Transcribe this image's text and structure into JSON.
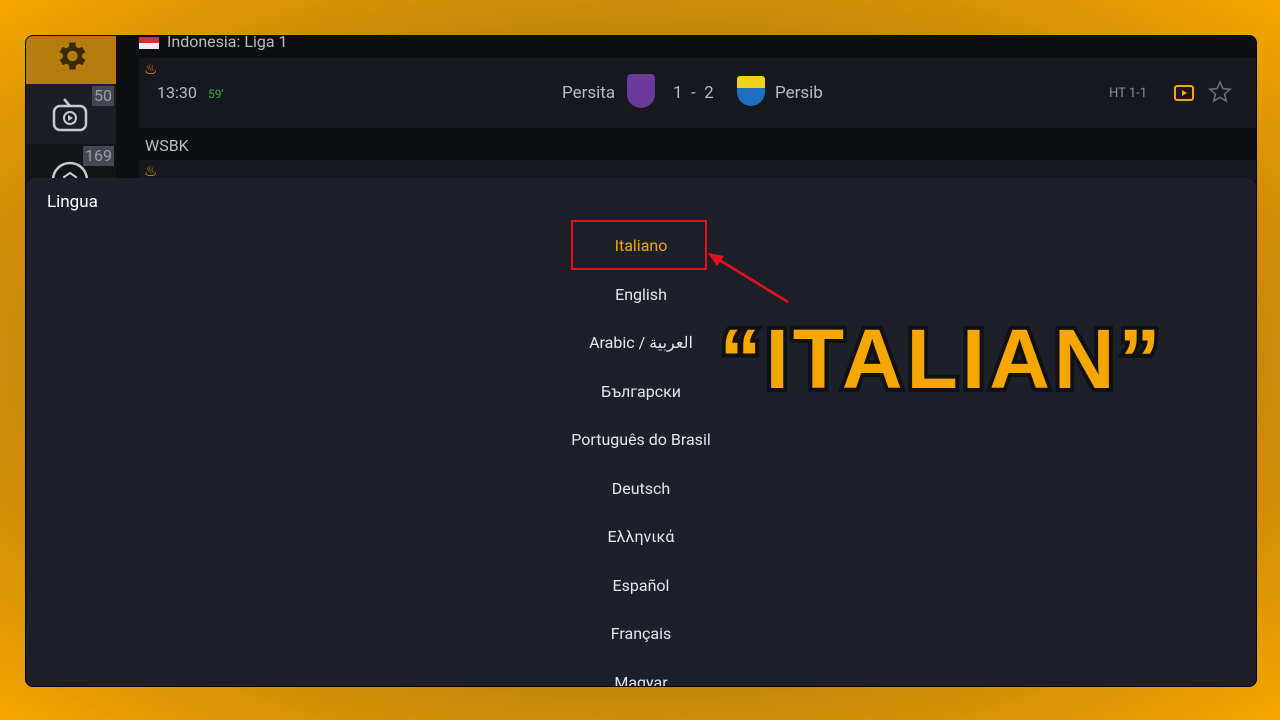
{
  "sidebar": {
    "items": [
      {
        "icon": "gear-icon",
        "count": ""
      },
      {
        "icon": "live-tv-icon",
        "count": "50"
      },
      {
        "icon": "soccer-ball-icon",
        "count": "169"
      }
    ]
  },
  "matches": {
    "league1": "Indonesia: Liga 1",
    "match1": {
      "time": "13:30",
      "minute": "59'",
      "home": "Persita",
      "score": "1  -  2",
      "away": "Persib",
      "ht": "HT 1-1"
    },
    "league2": "WSBK"
  },
  "modal": {
    "title": "Lingua",
    "languages": [
      "Italiano",
      "English",
      "Arabic / العربية",
      "Български",
      "Português do Brasil",
      "Deutsch",
      "Ελληνικά",
      "Español",
      "Français",
      "Magyar"
    ],
    "selected_index": 0
  },
  "annotation": {
    "text": "“ITALIAN”"
  },
  "colors": {
    "accent": "#f5a700",
    "highlight": "#e8101c",
    "modal_bg": "#1e2029"
  }
}
